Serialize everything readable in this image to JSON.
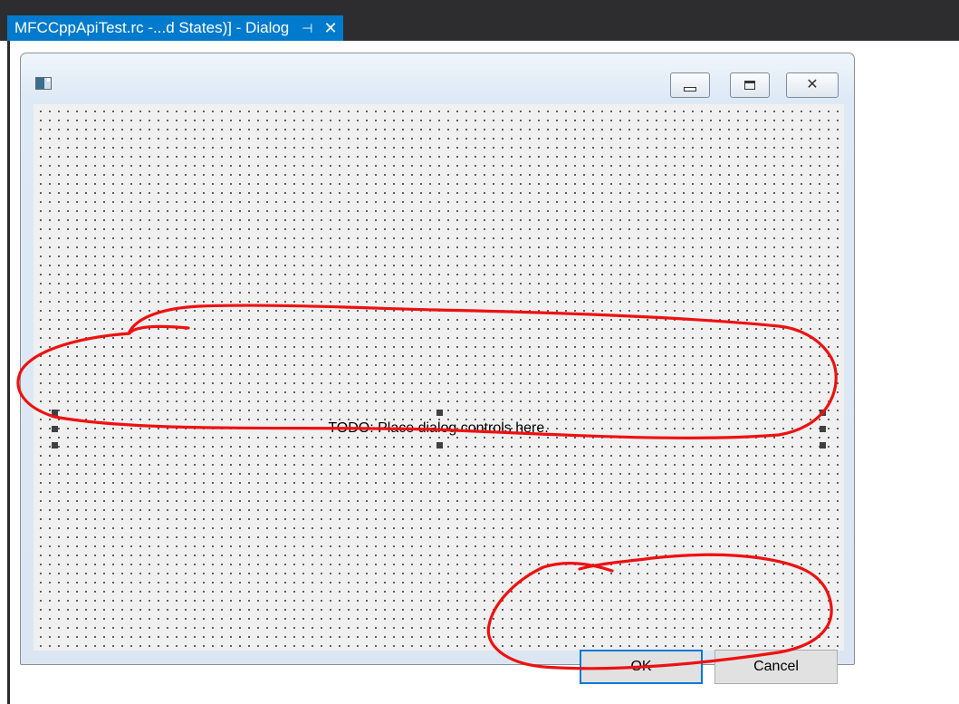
{
  "tab": {
    "title": "MFCCppApiTest.rc -...d States)] - Dialog",
    "pin_glyph": "⊣",
    "close_glyph": "✕",
    "color": "#007acc"
  },
  "dialog": {
    "caption_buttons": {
      "close_glyph": "✕"
    },
    "static_text": "TODO: Place dialog controls here.",
    "ok_label": "OK",
    "cancel_label": "Cancel"
  },
  "annotation_color": "#ee1111"
}
